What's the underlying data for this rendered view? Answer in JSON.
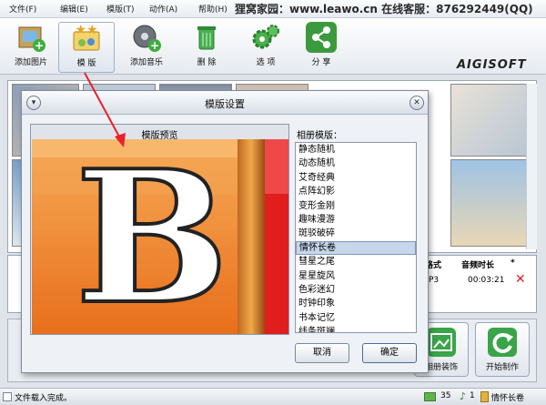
{
  "menu": {
    "items": [
      "文件(F)",
      "编辑(E)",
      "模版(T)",
      "动作(A)",
      "帮助(H)"
    ],
    "banner": "狸窝家园：www.leawo.cn 在线客服：876292449(QQ)"
  },
  "toolbar": {
    "items": [
      {
        "label": "添加图片",
        "icon": "add-image-icon",
        "color": "#c8a25a"
      },
      {
        "label": "模 版",
        "icon": "template-icon",
        "color": "#e2b23c"
      },
      {
        "label": "添加音乐",
        "icon": "add-music-icon",
        "color": "#8a8f96"
      },
      {
        "label": "删 除",
        "icon": "trash-icon",
        "color": "#3fa54a"
      },
      {
        "label": "选 项",
        "icon": "gear-icon",
        "color": "#49b04a"
      },
      {
        "label": "分 享",
        "icon": "share-icon",
        "color": "#3c9a3e"
      }
    ],
    "logo": "AIGISOFT"
  },
  "tracks": {
    "headers": {
      "format": "格式",
      "duration": "音频时长",
      "del": "*"
    },
    "row": {
      "format": "P3",
      "duration": "00:03:21"
    }
  },
  "bottom": {
    "decorate_label": "相册装饰",
    "start_label": "开始制作"
  },
  "status": {
    "text": "文件载入完成。",
    "image_count": "35",
    "music_count": "1",
    "template": "情怀长卷"
  },
  "dialog": {
    "title": "模版设置",
    "preview_label": "模版预览",
    "list_label": "相册模版：",
    "templates": [
      "静态随机",
      "动态随机",
      "艾奇经典",
      "点阵幻影",
      "变形金刚",
      "趣味漫游",
      "斑驳破碎",
      "情怀长卷",
      "彗星之尾",
      "星星旋风",
      "色彩迷幻",
      "时钟印象",
      "书本记忆",
      "线条斑斓"
    ],
    "selected_index": 7,
    "preview_letter": "B",
    "cancel_label": "取消",
    "ok_label": "确定",
    "colors": {
      "preview_orange": "#f08a2c",
      "preview_red": "#e01e1e",
      "accent_arrow": "#e8212a"
    }
  }
}
